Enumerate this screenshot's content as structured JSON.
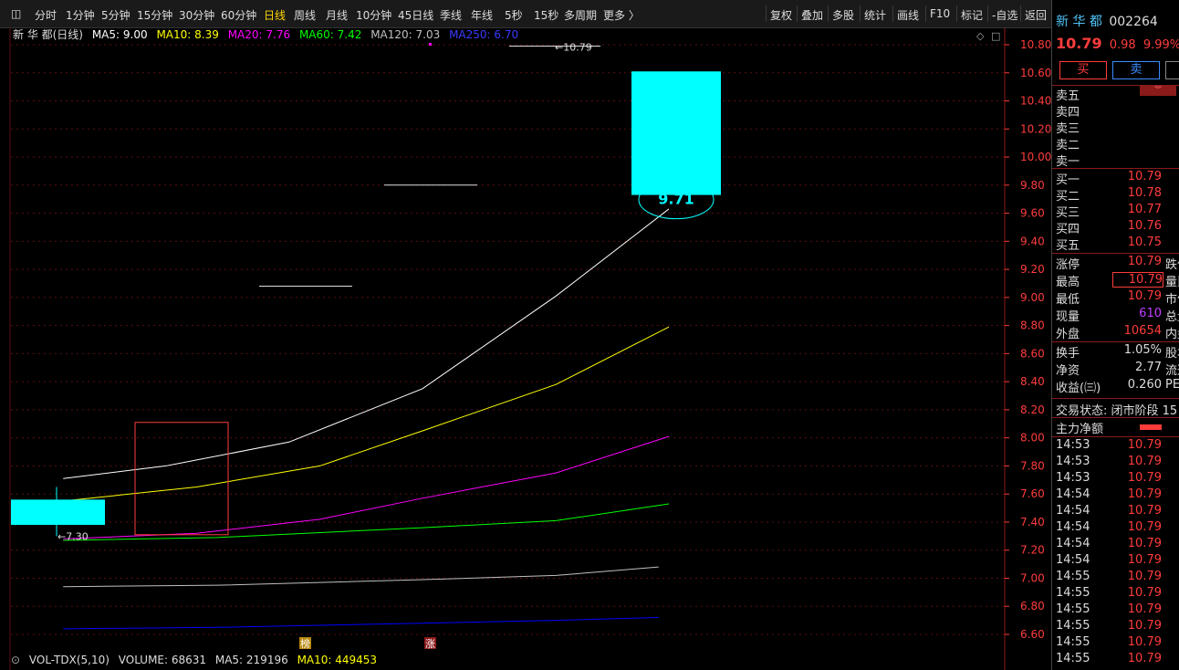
{
  "toolbar": {
    "left_items": [
      "分时",
      "1分钟",
      "5分钟",
      "15分钟",
      "30分钟",
      "60分钟",
      "日线",
      "周线",
      "月线",
      "10分钟",
      "45日线",
      "季线",
      "年线",
      "5秒",
      "15秒",
      "多周期",
      "更多 〉"
    ],
    "active": "日线",
    "right_items": [
      "复权",
      "叠加",
      "多股",
      "统计",
      "画线",
      "F10",
      "标记",
      "-自选",
      "返回"
    ]
  },
  "legend": {
    "title": "新 华 都(日线)",
    "ma5": "MA5: 9.00",
    "ma10": "MA10: 8.39",
    "ma20": "MA20: 7.76",
    "ma60": "MA60: 7.42",
    "ma120": "MA120: 7.03",
    "ma250": "MA250: 6.70"
  },
  "colors": {
    "ma5": "#ffffff",
    "ma10": "#ffff00",
    "ma20": "#ff00ff",
    "ma60": "#00ff00",
    "ma120": "#c0c0c0",
    "ma250": "#0000ff",
    "candle_up": "#00ffff",
    "axis": "#ff3c3c",
    "grid": "#5a1010"
  },
  "chart_data": {
    "type": "line",
    "title": "新 华 都(日线)",
    "ylim": [
      6.5,
      10.95
    ],
    "y_ticks": [
      "10.80",
      "10.60",
      "10.40",
      "10.20",
      "10.00",
      "9.80",
      "9.60",
      "9.40",
      "9.20",
      "9.00",
      "8.80",
      "8.60",
      "8.40",
      "8.20",
      "8.00",
      "7.80",
      "7.60",
      "7.40",
      "7.20",
      "7.00",
      "6.80",
      "6.60"
    ],
    "candles": [
      {
        "x": 0,
        "open": 7.38,
        "close": 7.56,
        "high": 7.56,
        "low": 7.38
      },
      {
        "x": 6,
        "open": 9.73,
        "close": 10.61,
        "high": 10.61,
        "low": 9.73
      }
    ],
    "series": [
      {
        "name": "MA5",
        "points": [
          [
            0.5,
            7.71
          ],
          [
            1.5,
            7.8
          ],
          [
            2.7,
            7.97
          ],
          [
            4.0,
            8.35
          ],
          [
            5.3,
            9.01
          ],
          [
            6.4,
            9.63
          ]
        ]
      },
      {
        "name": "MA10",
        "points": [
          [
            0.5,
            7.55
          ],
          [
            1.8,
            7.65
          ],
          [
            3.0,
            7.8
          ],
          [
            4.0,
            8.05
          ],
          [
            5.3,
            8.38
          ],
          [
            6.4,
            8.79
          ]
        ]
      },
      {
        "name": "MA20",
        "points": [
          [
            0.5,
            7.28
          ],
          [
            1.8,
            7.32
          ],
          [
            3.0,
            7.42
          ],
          [
            4.0,
            7.57
          ],
          [
            5.3,
            7.75
          ],
          [
            6.4,
            8.01
          ]
        ]
      },
      {
        "name": "MA60",
        "points": [
          [
            0.5,
            7.27
          ],
          [
            2.0,
            7.29
          ],
          [
            4.0,
            7.36
          ],
          [
            5.3,
            7.41
          ],
          [
            6.4,
            7.53
          ]
        ]
      },
      {
        "name": "MA120",
        "points": [
          [
            0.5,
            6.94
          ],
          [
            2.0,
            6.95
          ],
          [
            4.0,
            6.99
          ],
          [
            5.3,
            7.02
          ],
          [
            6.3,
            7.08
          ]
        ]
      },
      {
        "name": "MA250",
        "points": [
          [
            0.5,
            6.64
          ],
          [
            2.0,
            6.65
          ],
          [
            4.0,
            6.68
          ],
          [
            5.3,
            6.7
          ],
          [
            6.3,
            6.72
          ]
        ]
      }
    ],
    "annotations": {
      "high_label": "10.79",
      "low_label": "7.30",
      "close_label": "9.71",
      "markers": [
        "榜",
        "涨"
      ]
    }
  },
  "volume_bar": {
    "label": "VOL-TDX(5,10)",
    "volume": "VOLUME: 68631",
    "ma5": "MA5: 219196",
    "ma10": "MA10: 449453"
  },
  "quote": {
    "name": "新 华 都",
    "code": "002264",
    "price": "10.79",
    "change": "0.98",
    "pct": "9.99%",
    "buy_label": "买",
    "sell_label": "卖",
    "sell_levels": [
      "卖五",
      "卖四",
      "卖三",
      "卖二",
      "卖一"
    ],
    "buy_levels": [
      {
        "label": "买一",
        "price": "10.79"
      },
      {
        "label": "买二",
        "price": "10.78"
      },
      {
        "label": "买三",
        "price": "10.77"
      },
      {
        "label": "买四",
        "price": "10.76"
      },
      {
        "label": "买五",
        "price": "10.75"
      }
    ],
    "stats": [
      {
        "label": "涨停",
        "value": "10.79",
        "extra": "跌停"
      },
      {
        "label": "最高",
        "value": "10.79",
        "extra": "量比"
      },
      {
        "label": "最低",
        "value": "10.79",
        "extra": "市值"
      },
      {
        "label": "现量",
        "value": "610",
        "extra": "总量"
      },
      {
        "label": "外盘",
        "value": "10654",
        "extra": "内盘"
      }
    ],
    "stats2": [
      {
        "label": "换手",
        "value": "1.05%",
        "extra": "股本"
      },
      {
        "label": "净资",
        "value": "2.77",
        "extra": "流通"
      },
      {
        "label": "收益(㈢)",
        "value": "0.260",
        "extra": "PE"
      }
    ],
    "status": "交易状态: 闭市阶段 15",
    "main_flow": "主力净额",
    "ticks": [
      {
        "time": "14:53",
        "price": "10.79"
      },
      {
        "time": "14:53",
        "price": "10.79"
      },
      {
        "time": "14:53",
        "price": "10.79"
      },
      {
        "time": "14:54",
        "price": "10.79"
      },
      {
        "time": "14:54",
        "price": "10.79"
      },
      {
        "time": "14:54",
        "price": "10.79"
      },
      {
        "time": "14:54",
        "price": "10.79"
      },
      {
        "time": "14:54",
        "price": "10.79"
      },
      {
        "time": "14:55",
        "price": "10.79"
      },
      {
        "time": "14:55",
        "price": "10.79"
      },
      {
        "time": "14:55",
        "price": "10.79"
      },
      {
        "time": "14:55",
        "price": "10.79"
      },
      {
        "time": "14:55",
        "price": "10.79"
      },
      {
        "time": "14:55",
        "price": "10.79"
      }
    ]
  }
}
